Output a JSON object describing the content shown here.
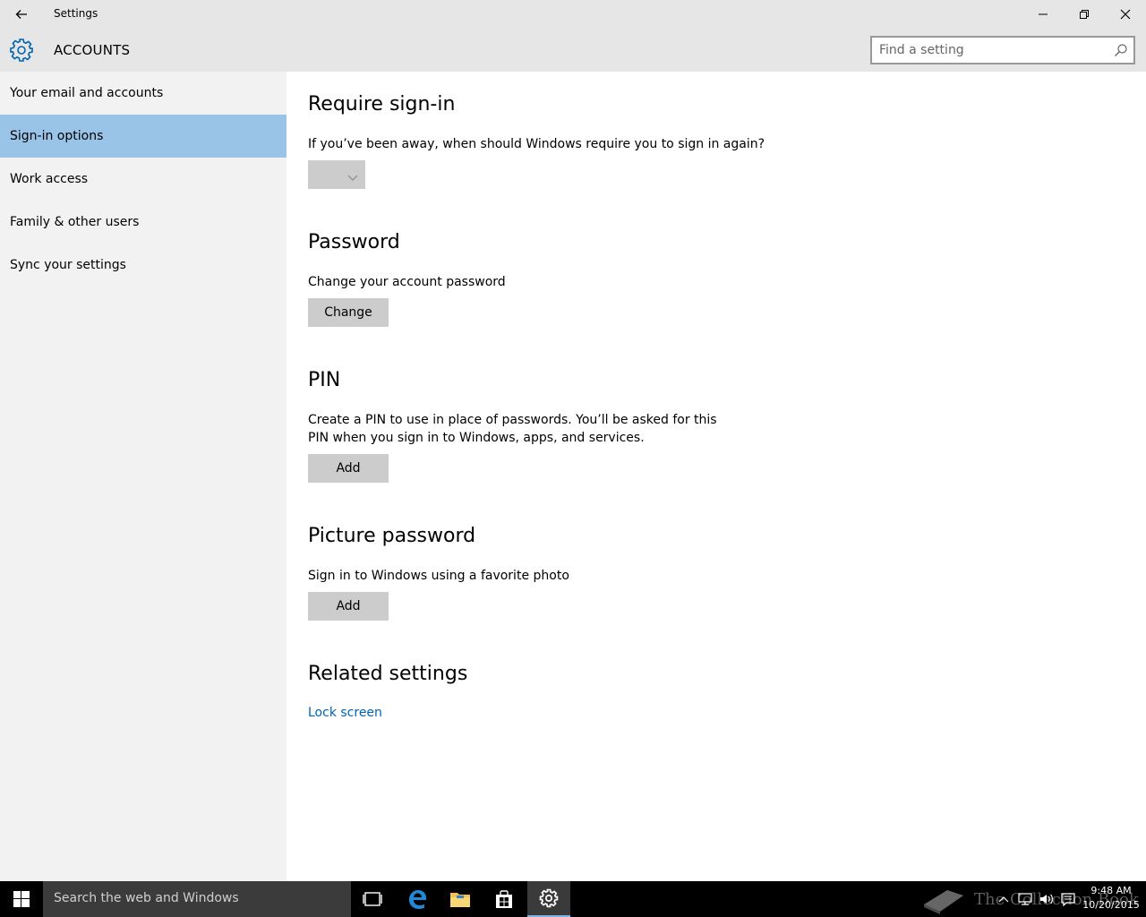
{
  "window": {
    "title": "Settings",
    "back_icon": "back-arrow-icon",
    "controls": [
      "minimize-icon",
      "maximize-icon",
      "close-icon"
    ]
  },
  "header": {
    "title": "ACCOUNTS",
    "icon": "gear-icon",
    "search_placeholder": "Find a setting",
    "accent": "#0063b1"
  },
  "sidebar": {
    "items": [
      {
        "label": "Your email and accounts",
        "selected": false
      },
      {
        "label": "Sign-in options",
        "selected": true
      },
      {
        "label": "Work access",
        "selected": false
      },
      {
        "label": "Family & other users",
        "selected": false
      },
      {
        "label": "Sync your settings",
        "selected": false
      }
    ],
    "selected_color": "#99c4e8"
  },
  "main": {
    "require_signin": {
      "heading": "Require sign-in",
      "description": "If you’ve been away, when should Windows require you to sign in again?",
      "dropdown_value": ""
    },
    "password": {
      "heading": "Password",
      "description": "Change your account password",
      "button": "Change"
    },
    "pin": {
      "heading": "PIN",
      "description_line1": "Create a PIN to use in place of passwords. You’ll be asked for this",
      "description_line2": "PIN when you sign in to Windows, apps, and services.",
      "button": "Add"
    },
    "picture_password": {
      "heading": "Picture password",
      "description": "Sign in to Windows using a favorite photo",
      "button": "Add"
    },
    "related": {
      "heading": "Related settings",
      "link": "Lock screen"
    }
  },
  "taskbar": {
    "search_text": "Search the web and Windows",
    "apps": [
      "task-view-icon",
      "edge-icon",
      "file-explorer-icon",
      "store-icon",
      "settings-icon"
    ],
    "active_app": "settings-icon",
    "watermark": "The Collection Book",
    "time": "9:48 AM",
    "date": "10/20/2015"
  }
}
